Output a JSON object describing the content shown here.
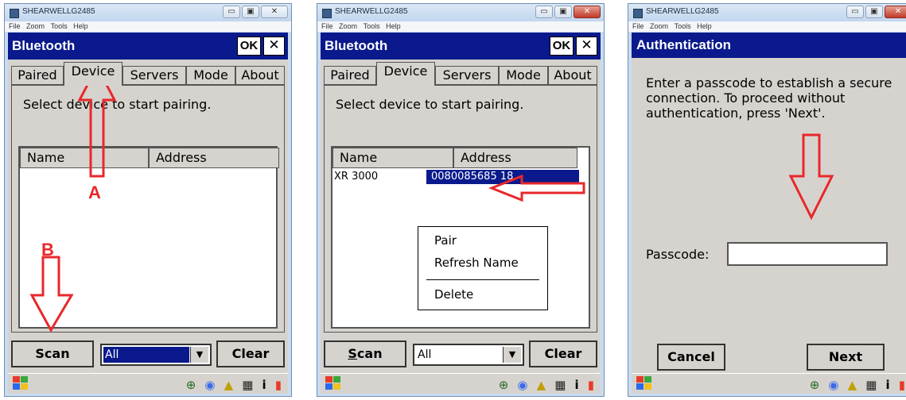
{
  "window_title": "SHEARWELLG2485",
  "menu": [
    "File",
    "Zoom",
    "Tools",
    "Help"
  ],
  "bluetooth": {
    "title": "Bluetooth",
    "ok_label": "OK",
    "close_label": "✕",
    "tabs": [
      "Paired",
      "Device",
      "Servers",
      "Mode",
      "About"
    ],
    "active_tab": "Device",
    "instruction": "Select device to start pairing.",
    "columns": [
      "Name",
      "Address"
    ],
    "scan_label": "Scan",
    "clear_label": "Clear",
    "filter_value": "All"
  },
  "screen2": {
    "device_name": "XR 3000",
    "device_address": "0080085685 18",
    "context_menu": [
      "Pair",
      "Refresh Name",
      "Delete"
    ]
  },
  "auth": {
    "title": "Authentication",
    "text": "Enter a passcode to establish a secure connection. To proceed without authentication, press 'Next'.",
    "passcode_label": "Passcode:",
    "passcode_value": "",
    "cancel_label": "Cancel",
    "next_label": "Next"
  },
  "annotations": {
    "label_a": "A",
    "label_b": "B",
    "color": "#e8282b"
  },
  "colors": {
    "header_blue": "#0a1a8c",
    "face_gray": "#d6d3ce"
  },
  "icons": {
    "start": "windows-flag-icon",
    "tray": [
      "network-globe-icon",
      "bluetooth-icon",
      "lock-icon",
      "keyboard-icon",
      "info-icon",
      "battery-icon"
    ]
  }
}
